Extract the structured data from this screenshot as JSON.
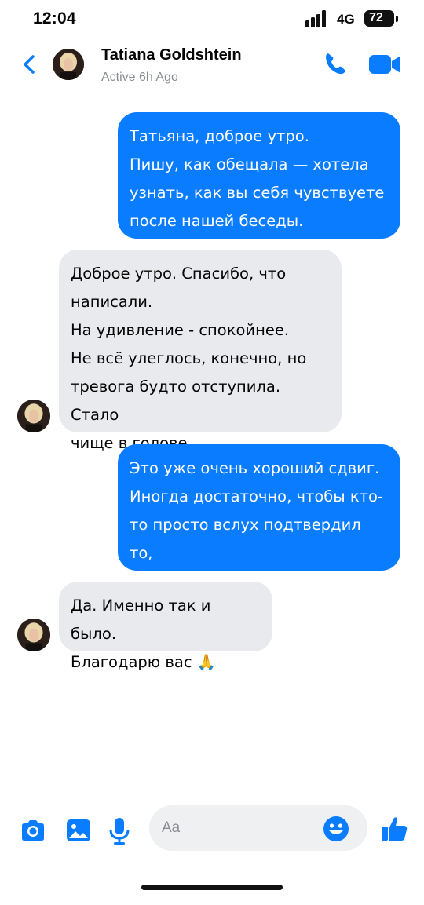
{
  "status_bar": {
    "time": "12:04",
    "network": "4G",
    "battery": "72"
  },
  "header": {
    "contact_name": "Tatiana Goldshtein",
    "contact_status": "Active 6h Ago",
    "icons": {
      "back": "chevron-left-icon",
      "call": "phone-icon",
      "video": "video-camera-icon"
    }
  },
  "messages": [
    {
      "direction": "outgoing",
      "text": "Татьяна, доброе утро.\nПишу, как обещала — хотела\nузнать, как вы себя чувствуете\nпосле нашей беседы."
    },
    {
      "direction": "incoming",
      "text": "Доброе утро. Спасибо, что\nнаписали.\nНа удивление - спокойнее.\nНе всё улеглось, конечно, но\nтревога будто отступила. Стало\nчище в голове."
    },
    {
      "direction": "outgoing",
      "text": "Это уже очень хороший сдвиг.\nИногда достаточно, чтобы кто-\nто просто вслух подтвердил то,\nчто вы и так чувствовали."
    },
    {
      "direction": "incoming",
      "text": "Да. Именно так и было.\nБлагодарю вас 🙏"
    }
  ],
  "composer": {
    "placeholder": "Aa",
    "icons": [
      "camera-icon",
      "gallery-icon",
      "microphone-icon",
      "emoji-icon",
      "thumbs-up-icon"
    ]
  },
  "colors": {
    "accent": "#0a7cff",
    "incoming_bubble": "#e9eaed",
    "muted_text": "#8a8d91"
  }
}
